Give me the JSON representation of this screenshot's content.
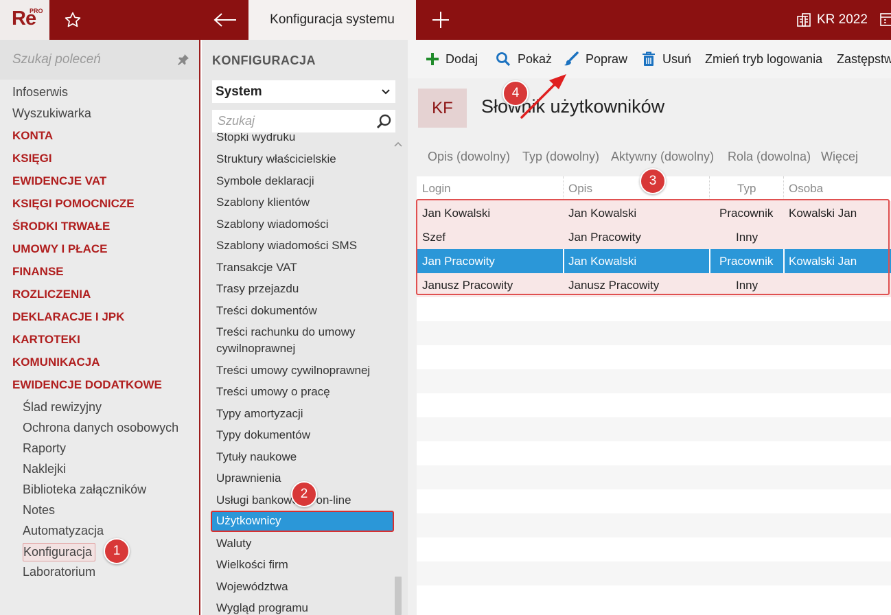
{
  "topbar": {
    "logo_text": "Re",
    "logo_sup": "PRO",
    "active_tab": "Konfiguracja systemu",
    "year_label": "KR 2022"
  },
  "leftnav": {
    "search_placeholder": "Szukaj poleceń",
    "items": [
      {
        "label": "Infoserwis",
        "kind": "plain"
      },
      {
        "label": "Wyszukiwarka",
        "kind": "plain"
      },
      {
        "label": "KONTA",
        "kind": "category"
      },
      {
        "label": "KSIĘGI",
        "kind": "category"
      },
      {
        "label": "EWIDENCJE VAT",
        "kind": "category"
      },
      {
        "label": "KSIĘGI POMOCNICZE",
        "kind": "category"
      },
      {
        "label": "ŚRODKI TRWAŁE",
        "kind": "category"
      },
      {
        "label": "UMOWY I PŁACE",
        "kind": "category"
      },
      {
        "label": "FINANSE",
        "kind": "category"
      },
      {
        "label": "ROZLICZENIA",
        "kind": "category"
      },
      {
        "label": "DEKLARACJE I JPK",
        "kind": "category"
      },
      {
        "label": "KARTOTEKI",
        "kind": "category"
      },
      {
        "label": "KOMUNIKACJA",
        "kind": "category"
      },
      {
        "label": "EWIDENCJE DODATKOWE",
        "kind": "category"
      }
    ],
    "subitems": [
      "Ślad rewizyjny",
      "Ochrona danych osobowych",
      "Raporty",
      "Naklejki",
      "Biblioteka załączników",
      "Notes",
      "Automatyzacja",
      "Konfiguracja",
      "Laboratorium"
    ],
    "selected_subitem": "Konfiguracja"
  },
  "midpanel": {
    "title": "KONFIGURACJA",
    "select_value": "System",
    "search_placeholder": "Szukaj",
    "items": [
      "Stopki wydruku",
      "Struktury właścicielskie",
      "Symbole deklaracji",
      "Szablony klientów",
      "Szablony wiadomości",
      "Szablony wiadomości SMS",
      "Transakcje VAT",
      "Trasy przejazdu",
      "Treści dokumentów",
      "Treści rachunku do umowy cywilnoprawnej",
      "Treści umowy cywilnoprawnej",
      "Treści umowy o pracę",
      "Typy amortyzacji",
      "Typy dokumentów",
      "Tytuły naukowe",
      "Uprawnienia",
      "Usługi bankowości on-line",
      "Użytkownicy",
      "Waluty",
      "Wielkości firm",
      "Województwa",
      "Wygląd programu"
    ],
    "selected_item": "Użytkownicy"
  },
  "toolbar": {
    "add": "Dodaj",
    "show": "Pokaż",
    "edit": "Popraw",
    "delete": "Usuń",
    "change_login": "Zmień tryb logowania",
    "substitutions": "Zastępstw"
  },
  "dictionary": {
    "badge": "KF",
    "title": "Słownik użytkowników",
    "filters": [
      "Opis (dowolny)",
      "Typ (dowolny)",
      "Aktywny (dowolny)",
      "Rola (dowolna)",
      "Więcej"
    ],
    "columns": [
      "Login",
      "Opis",
      "Typ",
      "Osoba"
    ],
    "rows": [
      {
        "login": "Jan Kowalski",
        "opis": "Jan Kowalski",
        "typ": "Pracownik",
        "osoba": "Kowalski Jan"
      },
      {
        "login": "Szef",
        "opis": "Jan Pracowity",
        "typ": "Inny",
        "osoba": ""
      },
      {
        "login": "Jan Pracowity",
        "opis": "Jan Kowalski",
        "typ": "Pracownik",
        "osoba": "Kowalski Jan"
      },
      {
        "login": "Janusz Pracowity",
        "opis": "Janusz Pracowity",
        "typ": "Inny",
        "osoba": ""
      }
    ]
  },
  "annotations": [
    "1",
    "2",
    "3",
    "4"
  ],
  "colors": {
    "brand": "#8b1111",
    "category": "#b01e1e",
    "selection": "#2b97d8",
    "marker": "#d83838"
  }
}
